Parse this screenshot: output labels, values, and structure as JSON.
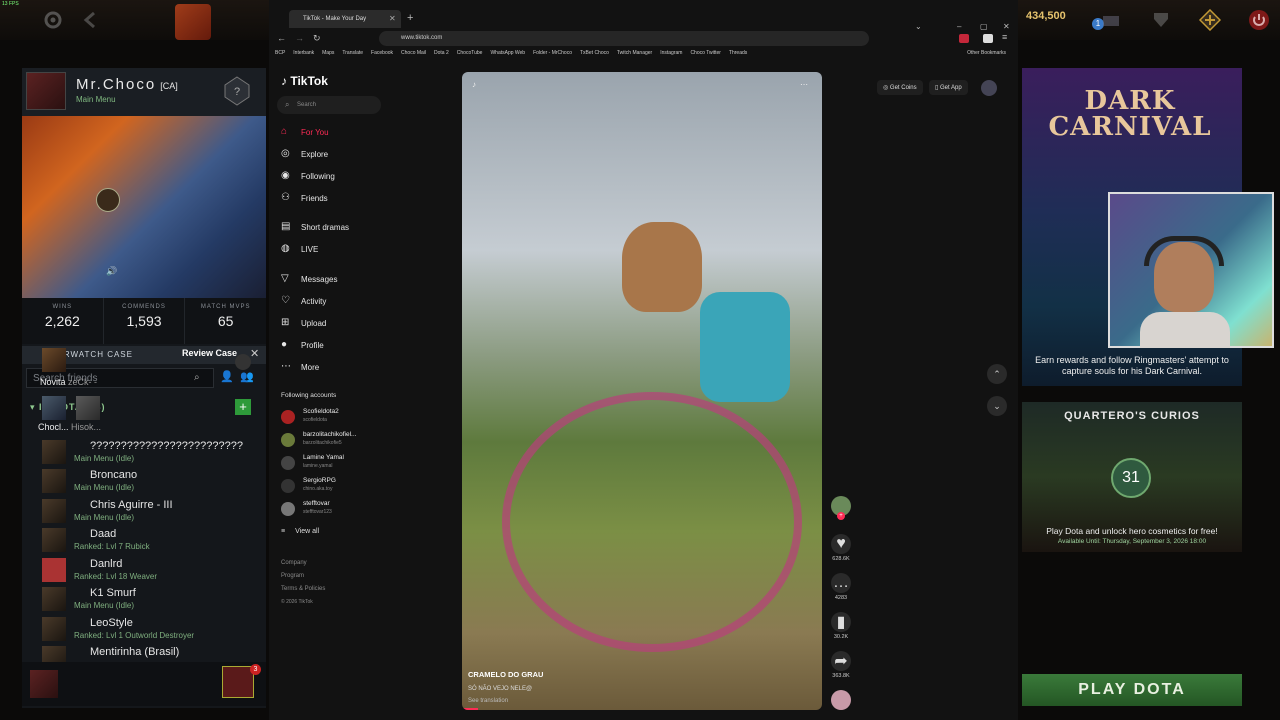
{
  "dota": {
    "fps": "13 FPS",
    "gold": "434,500",
    "notif_count": "1",
    "profile": {
      "name": "Mr.Choco",
      "tag": "[CA]",
      "status": "Main Menu",
      "stats": [
        {
          "label": "WINS",
          "value": "2,262"
        },
        {
          "label": "COMMENDS",
          "value": "1,593"
        },
        {
          "label": "MATCH MVPS",
          "value": "65"
        }
      ]
    },
    "overwatch": {
      "label": "OVERWATCH CASE",
      "review": "Review Case"
    },
    "search_placeholder": "Search friends",
    "in_dota": "IN DOTA (18)",
    "party": [
      {
        "name": "Novita",
        "extra": "zeCk- -"
      },
      {
        "name": "Chocl...",
        "extra": "Hisok..."
      }
    ],
    "friends": [
      {
        "name": "?????????????????????????",
        "status": "Main Menu (Idle)"
      },
      {
        "name": "Broncano",
        "status": "Main Menu (Idle)"
      },
      {
        "name": "Chris Aguirre - III",
        "status": "Main Menu (Idle)"
      },
      {
        "name": "Daad",
        "status": "Ranked: Lvl 7 Rubick"
      },
      {
        "name": "Danlrd",
        "status": "Ranked: Lvl 18 Weaver"
      },
      {
        "name": "K1 Smurf",
        "status": "Main Menu (Idle)"
      },
      {
        "name": "LeoStyle",
        "status": "Ranked: Lvl 1 Outworld Destroyer"
      },
      {
        "name": "Mentirinha (Brasil)",
        "status": ""
      }
    ],
    "chat_badge": "3",
    "dark_carnival": {
      "title_line1": "DARK",
      "title_line2": "CARNIVAL",
      "text": "Earn rewards and follow Ringmasters' attempt to capture souls for his Dark Carnival."
    },
    "quarteros": {
      "title": "QUARTERO'S CURIOS",
      "badge": "31",
      "text": "Play Dota and unlock hero cosmetics for free!",
      "date": "Available Until: Thursday, September 3, 2026 18:00"
    },
    "play_button": "PLAY DOTA"
  },
  "browser": {
    "tab_title": "TikTok - Make Your Day",
    "url": "www.tiktok.com",
    "bookmarks": [
      "BCP",
      "Interbank",
      "Maps",
      "Translate",
      "Facebook",
      "Choco Mail",
      "Dota 2",
      "ChocoTube",
      "WhatsApp Web",
      "Folder - MrChoco",
      "TxBet Choco",
      "Twitch Manager",
      "Instagram",
      "Choco Twitter",
      "Threads",
      "Other Bookmarks"
    ]
  },
  "tiktok": {
    "logo": "TikTok",
    "search_placeholder": "Search",
    "nav": [
      "For You",
      "Explore",
      "Following",
      "Friends",
      "Short dramas",
      "LIVE",
      "Messages",
      "Activity",
      "Upload",
      "Profile",
      "More"
    ],
    "following_title": "Following accounts",
    "accounts": [
      {
        "name": "Scofieldota2",
        "handle": "scofieldota"
      },
      {
        "name": "barzolitachikofiel...",
        "handle": "barzolitachikofie5"
      },
      {
        "name": "Lamine Yamal",
        "handle": "lamine.yamal"
      },
      {
        "name": "SergioRPG",
        "handle": "chino.aka.toy"
      },
      {
        "name": "stefftovar",
        "handle": "stefftovar123"
      }
    ],
    "view_all": "View all",
    "footer": [
      "Company",
      "Program",
      "Terms & Policies",
      "© 2026 TikTok"
    ],
    "get_coins": "Get Coins",
    "get_app": "Get App",
    "video": {
      "author": "CRAMELO DO GRAU",
      "caption": "SÓ NÃO VEJO NELE@",
      "see_translation": "See translation"
    },
    "actions": [
      {
        "icon": "heart-icon",
        "count": "628.6K"
      },
      {
        "icon": "comment-icon",
        "count": "4283"
      },
      {
        "icon": "bookmark-icon",
        "count": "30.2K"
      },
      {
        "icon": "share-icon",
        "count": "363.8K"
      }
    ]
  }
}
